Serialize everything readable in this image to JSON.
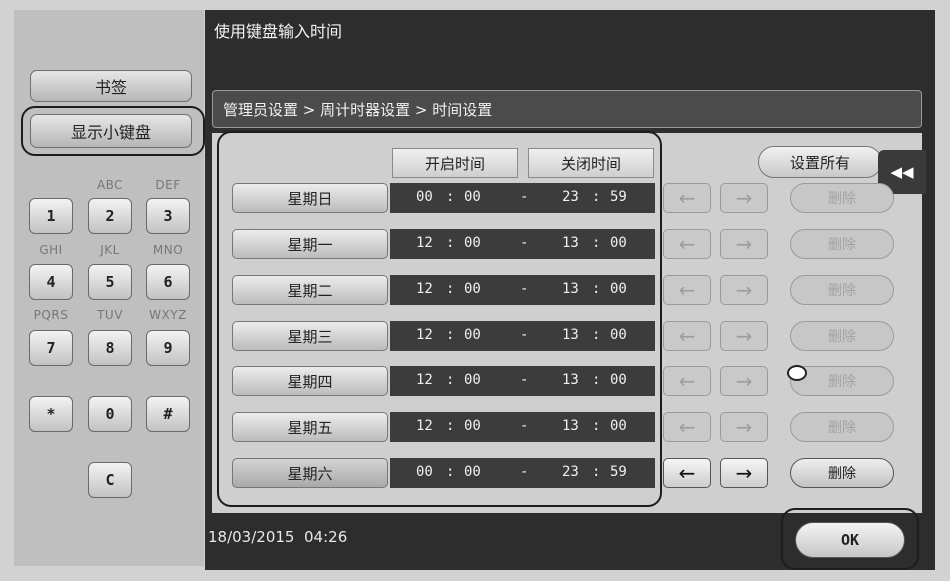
{
  "header": {
    "title": "使用键盘输入时间",
    "breadcrumb": "管理员设置 > 周计时器设置 > 时间设置"
  },
  "left_panel": {
    "bookmark_label": "书签",
    "show_keypad_label": "显示小键盘",
    "keypad": {
      "letters": [
        "ABC",
        "DEF",
        "GHI",
        "JKL",
        "MNO",
        "PQRS",
        "TUV",
        "WXYZ"
      ],
      "keys": [
        "1",
        "2",
        "3",
        "4",
        "5",
        "6",
        "7",
        "8",
        "9",
        "*",
        "0",
        "#",
        "C"
      ]
    }
  },
  "schedule": {
    "headers": {
      "start": "开启时间",
      "end": "关闭时间"
    },
    "separator": "-",
    "time_colon": ":",
    "rows": [
      {
        "day": "星期日",
        "start_h": "00",
        "start_m": "00",
        "end_h": "23",
        "end_m": "59"
      },
      {
        "day": "星期一",
        "start_h": "12",
        "start_m": "00",
        "end_h": "13",
        "end_m": "00"
      },
      {
        "day": "星期二",
        "start_h": "12",
        "start_m": "00",
        "end_h": "13",
        "end_m": "00"
      },
      {
        "day": "星期三",
        "start_h": "12",
        "start_m": "00",
        "end_h": "13",
        "end_m": "00"
      },
      {
        "day": "星期四",
        "start_h": "12",
        "start_m": "00",
        "end_h": "13",
        "end_m": "00"
      },
      {
        "day": "星期五",
        "start_h": "12",
        "start_m": "00",
        "end_h": "13",
        "end_m": "00"
      },
      {
        "day": "星期六",
        "start_h": "00",
        "start_m": "00",
        "end_h": "23",
        "end_m": "59"
      }
    ],
    "selected_row": 6
  },
  "controls": {
    "set_all_label": "设置所有",
    "delete_label": "删除",
    "arrow_left": "←",
    "arrow_right": "→",
    "collapse_icon": "◀◀",
    "ok_label": "OK"
  },
  "status": {
    "date": "18/03/2015",
    "time": "04:26"
  }
}
